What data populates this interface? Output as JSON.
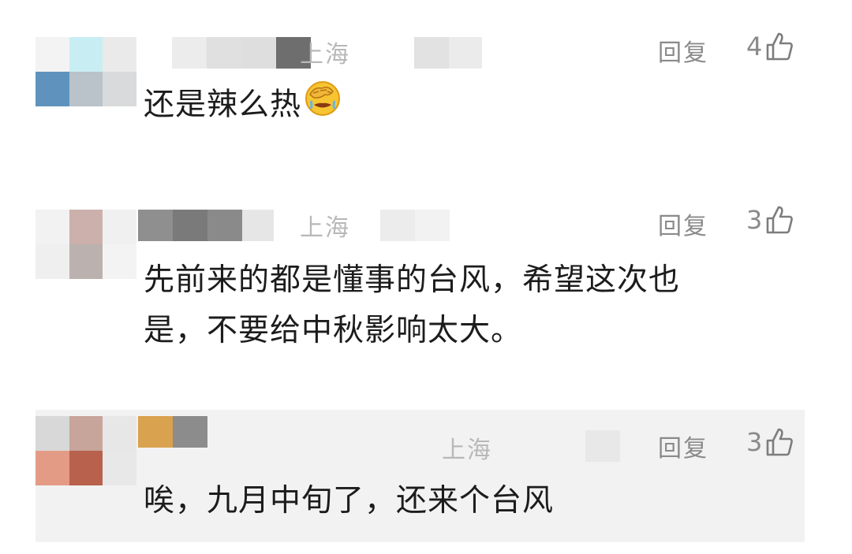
{
  "comments": [
    {
      "location": "上海",
      "reply_label": "回复",
      "like_count": "4",
      "text": "还是辣么热",
      "emoji": "face-palm-emoji",
      "avatar_colors": [
        "#f3f3f3",
        "#c8eef3",
        "#eaeaea",
        "#5f93bd",
        "#b9c3c9",
        "#d8dadb"
      ],
      "name_blur_colors": [
        "#ececec",
        "#e0e0e0",
        "#dedede",
        "#6e6e6e"
      ],
      "trailing_blur_colors": [
        "#e2e2e2",
        "#ebebeb"
      ]
    },
    {
      "location": "上海",
      "reply_label": "回复",
      "like_count": "3",
      "text_lines": [
        "先前来的都是懂事的台风，希望这次也",
        "是，不要给中秋影响太大。"
      ],
      "avatar_colors": [
        "#f2f2f2",
        "#ccb0ac",
        "#f0f0f0",
        "#efefef",
        "#bbb1ae",
        "#f3f3f3"
      ],
      "name_blur_colors": [
        "#8f8f8f",
        "#7a7a7a",
        "#8a8a8a",
        "#e6e6e6"
      ],
      "trailing_blur_colors": [
        "#ececec",
        "#f2f2f2"
      ]
    },
    {
      "location": "上海",
      "reply_label": "回复",
      "like_count": "3",
      "text": "唉，九月中旬了，还来个台风",
      "avatar_colors": [
        "#d8d8d8",
        "#c7a59b",
        "#e7e7e7",
        "#e49b86",
        "#b8614c",
        "#e8e8e8"
      ],
      "name_blur_colors": [
        "#d9a24f",
        "#8c8c8c"
      ],
      "trailing_blur_colors": [
        "#e8e8e8",
        "#dcdcdc"
      ]
    }
  ]
}
